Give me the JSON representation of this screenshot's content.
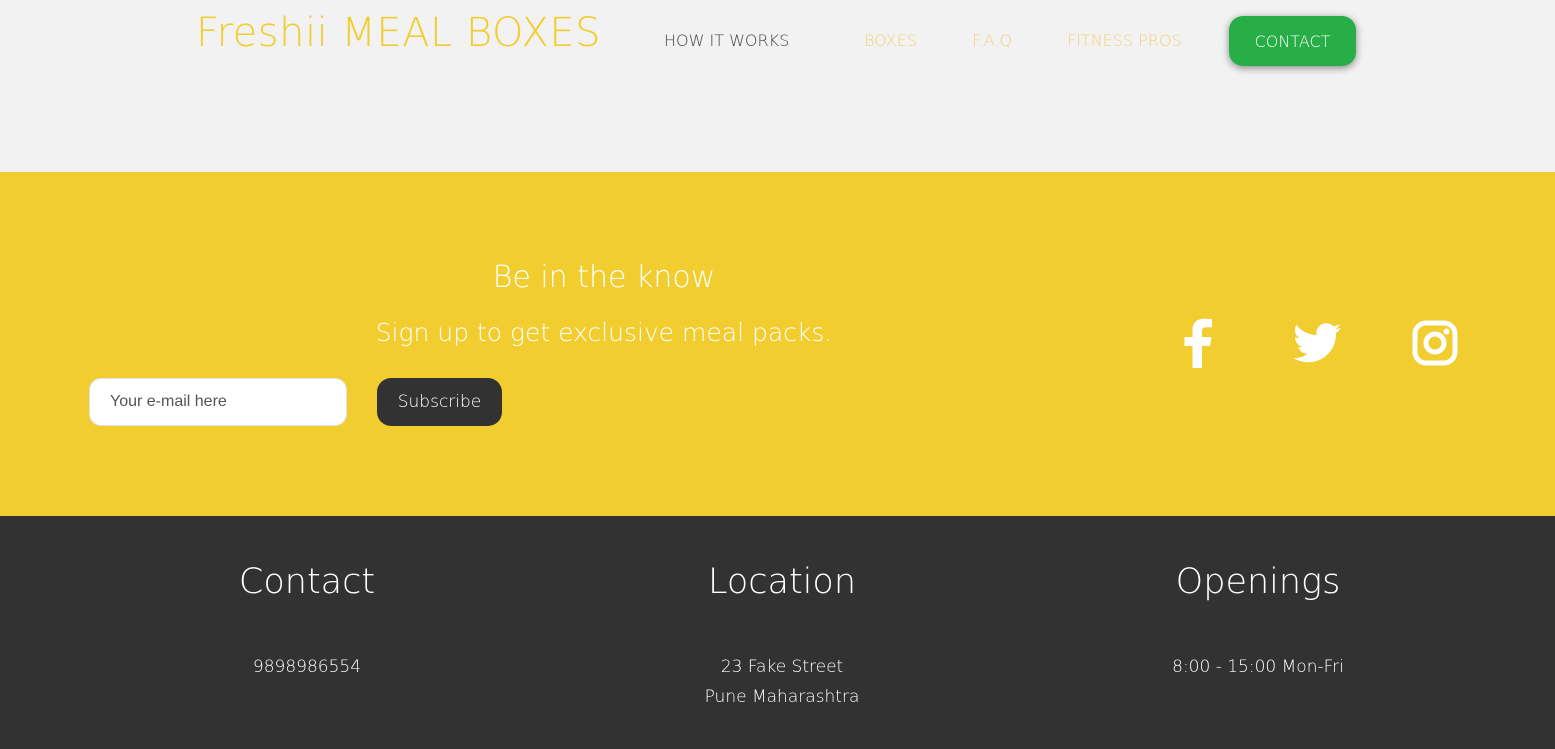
{
  "header": {
    "logo": "Freshii MEAL BOXES",
    "nav": {
      "how_it_works": "HOW IT WORKS",
      "boxes": "BOXES",
      "faq": "F.A.Q",
      "fitness_pros": "FITNESS PROS",
      "contact": "CONTACT"
    }
  },
  "newsletter": {
    "title": "Be in the know",
    "subtitle": "Sign up to get exclusive meal packs.",
    "email_placeholder": "Your e-mail here",
    "subscribe_label": "Subscribe",
    "social_icons": [
      "facebook-icon",
      "twitter-icon",
      "instagram-icon"
    ]
  },
  "footer": {
    "contact": {
      "heading": "Contact",
      "phone": "9898986554"
    },
    "location": {
      "heading": "Location",
      "street": "23 Fake Street",
      "city": "Pune Maharashtra"
    },
    "openings": {
      "heading": "Openings",
      "hours": "8:00 - 15:00 Mon-Fri"
    }
  },
  "colors": {
    "accent_yellow": "#f2cd2f",
    "contact_green": "#27ae46",
    "dark": "#323232",
    "light_bg": "#f2f2f2"
  }
}
